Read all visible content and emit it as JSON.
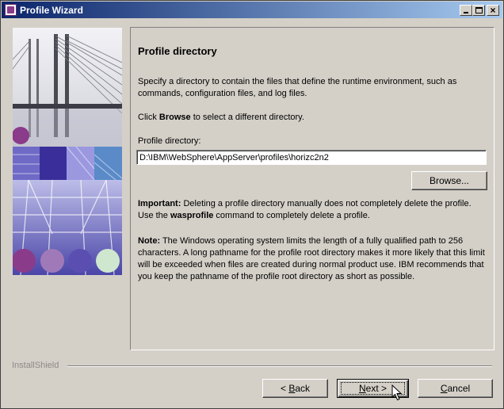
{
  "window": {
    "title": "Profile Wizard",
    "controls": {
      "minimize": "_",
      "maximize": "□",
      "close": "×"
    }
  },
  "panel": {
    "title": "Profile directory",
    "description": "Specify a directory to contain the files that define the runtime environment, such as commands, configuration files, and log files.",
    "click_prefix": "Click ",
    "click_bold": "Browse",
    "click_suffix": " to select a different directory.",
    "directory_label": "Profile directory:",
    "directory_value": "D:\\IBM\\WebSphere\\AppServer\\profiles\\horizc2n2",
    "browse_label": "Browse...",
    "important_bold": "Important:",
    "important_text1": " Deleting a profile directory manually does not completely delete the profile. Use the ",
    "important_cmd": "wasprofile",
    "important_text2": " command to completely delete a profile.",
    "note_bold": "Note:",
    "note_text": " The Windows operating system limits the length of a fully qualified path to 256 characters. A long pathname for the profile root directory makes it more likely that this limit will be exceeded when files are created during normal product use. IBM recommends that you keep the pathname of the profile root directory as short as possible."
  },
  "footer": {
    "brand": "InstallShield",
    "back_prefix": "< ",
    "back_key": "B",
    "back_rest": "ack",
    "next_prefix": "",
    "next_key": "N",
    "next_rest": "ext >",
    "cancel_key": "C",
    "cancel_rest": "ancel"
  },
  "colors": {
    "titlebar_start": "#0a246a",
    "titlebar_end": "#a6caf0",
    "face": "#d4d0c8",
    "art_purple": "#8a3b8a",
    "art_blue": "#5a4fb0"
  },
  "icons": [
    "wizard-app-icon",
    "minimize-icon",
    "maximize-icon",
    "close-icon",
    "mouse-cursor-icon"
  ]
}
